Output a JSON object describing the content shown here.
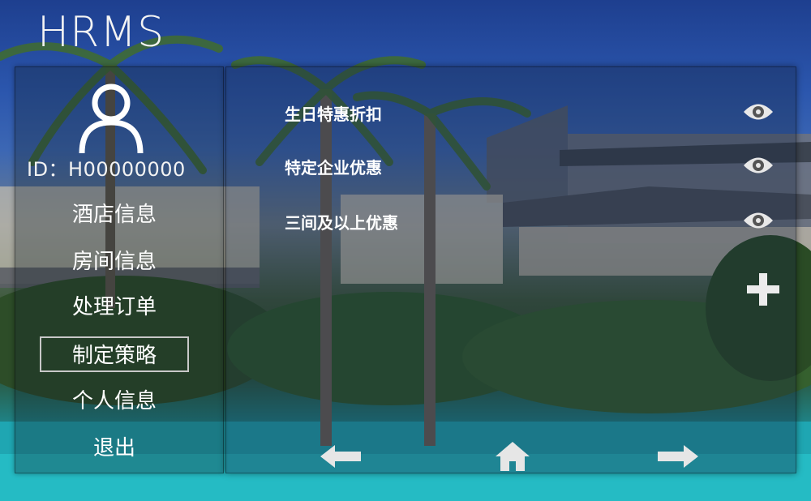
{
  "app": {
    "brand": "HRMS"
  },
  "user": {
    "id_text": "ID：H00000000"
  },
  "sidebar": {
    "items": [
      {
        "label": "酒店信息",
        "active": false
      },
      {
        "label": "房间信息",
        "active": false
      },
      {
        "label": "处理订单",
        "active": false
      },
      {
        "label": "制定策略",
        "active": true
      },
      {
        "label": "个人信息",
        "active": false
      },
      {
        "label": "退出",
        "active": false
      }
    ]
  },
  "promotions": [
    {
      "label": "生日特惠折扣",
      "action_icon": "eye-icon"
    },
    {
      "label": "特定企业优惠",
      "action_icon": "eye-icon"
    },
    {
      "label": "三间及以上优惠",
      "action_icon": "eye-icon"
    }
  ],
  "controls": {
    "add_icon": "plus-icon",
    "back_icon": "arrow-left-icon",
    "home_icon": "home-icon",
    "forward_icon": "arrow-right-icon"
  },
  "colors": {
    "panel_overlay": "#14233c",
    "sidebar_overlay": "#141e28",
    "text": "#ffffff",
    "active_border": "#c8c8c8",
    "icon": "#e8e8e8"
  }
}
